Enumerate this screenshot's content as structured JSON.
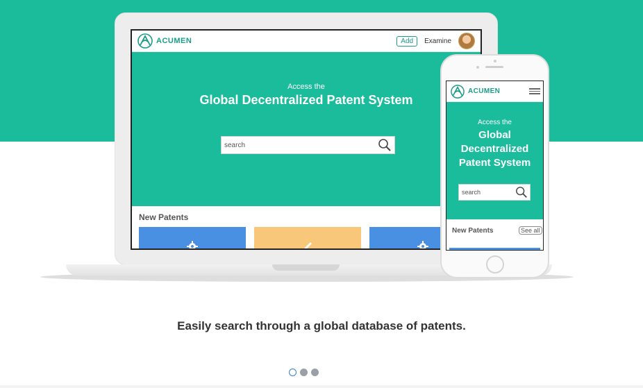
{
  "brand": {
    "name": "ACUMEN",
    "accent": "#1bbc9b",
    "dark_accent": "#1a9c86"
  },
  "desktop": {
    "nav": {
      "add_label": "Add",
      "examine_label": "Examine"
    },
    "hero": {
      "pre_title": "Access the",
      "title": "Global Decentralized Patent System"
    },
    "search": {
      "placeholder": "search"
    },
    "section_title": "New Patents",
    "cards": [
      {
        "color": "#4a90e2",
        "icon": "gear-icon"
      },
      {
        "color": "#f8c77a",
        "icon": "pencil-icon"
      },
      {
        "color": "#4a90e2",
        "icon": "gear-icon"
      }
    ]
  },
  "mobile": {
    "hero": {
      "pre_title": "Access the",
      "title": "Global Decentralized Patent System"
    },
    "search": {
      "placeholder": "search"
    },
    "section_title": "New Patents",
    "see_all_label": "See all"
  },
  "caption": "Easily search through a global database of patents.",
  "carousel": {
    "total": 3,
    "active": 0
  }
}
